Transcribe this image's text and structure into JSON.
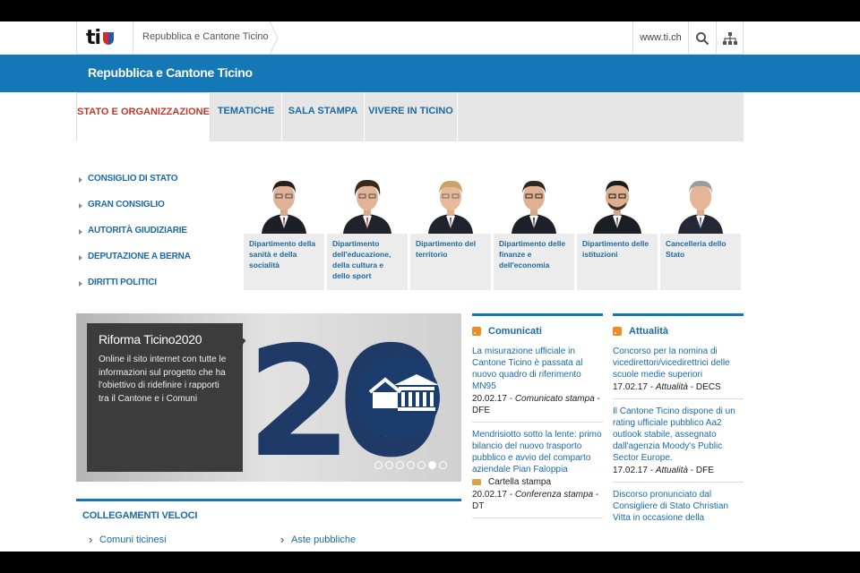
{
  "topbar": {
    "logo_text": "ti",
    "breadcrumb": "Repubblica e Cantone Ticino",
    "site_link": "www.ti.ch",
    "search_icon": "search-icon",
    "sitemap_icon": "sitemap-icon"
  },
  "band": {
    "title": "Repubblica e Cantone Ticino"
  },
  "tabs": [
    {
      "label": "STATO E ORGANIZZAZIONE",
      "active": true
    },
    {
      "label": "TEMATICHE"
    },
    {
      "label": "SALA STAMPA"
    },
    {
      "label": "VIVERE IN TICINO"
    }
  ],
  "leftnav": [
    {
      "label": "CONSIGLIO DI STATO"
    },
    {
      "label": "GRAN CONSIGLIO"
    },
    {
      "label": "AUTORITÀ GIUDIZIARIE"
    },
    {
      "label": "DEPUTAZIONE A BERNA"
    },
    {
      "label": "DIRITTI POLITICI"
    }
  ],
  "departments": [
    {
      "label": "Dipartimento della sanità e della socialità"
    },
    {
      "label": "Dipartimento dell'educazione, della cultura e dello sport"
    },
    {
      "label": "Dipartimento del territorio"
    },
    {
      "label": "Dipartimento delle finanze e dell'economia"
    },
    {
      "label": "Dipartimento delle istituzioni"
    },
    {
      "label": "Cancelleria dello Stato"
    }
  ],
  "hero": {
    "title": "Riforma Ticino2020",
    "text": "Online il sito internet con tutte le informazioni sul progetto che ha l'obiettivo di ridefinire i rapporti tra il Cantone e i Comuni",
    "art_text": "20",
    "slides_total": 6,
    "active_slide": 5
  },
  "quick_links": {
    "title": "COLLEGAMENTI VELOCI",
    "items": [
      "Comuni ticinesi",
      "Aste pubbliche"
    ]
  },
  "comunicati": {
    "title": "Comunicati",
    "items": [
      {
        "text": "La misurazione ufficiale in Cantone Ticino è passata al nuovo quadro di riferimento MN95",
        "date": "20.02.17",
        "type": "Comunicato stampa",
        "dept": "DFE"
      },
      {
        "text": "Mendrisiotto sotto la lente: primo bilancio del nuovo trasporto pubblico e avvio del comparto aziendale Pian Faloppia",
        "folder": "Cartella stampa",
        "date": "20.02.17",
        "type": "Conferenza stampa",
        "dept": "DT"
      }
    ]
  },
  "attualita": {
    "title": "Attualità",
    "items": [
      {
        "text": "Concorso per la nomina di vicedirettori/vicedirettrici delle scuole medie superiori",
        "date": "17.02.17",
        "type": "Attualità",
        "dept": "DECS"
      },
      {
        "text": "Il Cantone Ticino dispone di un rating ufficiale pubblico Aa2 outlook stabile, assegnato dall'agenzia Moody's Public Sector Europe.",
        "date": "17.02.17",
        "type": "Attualità",
        "dept": "DFE"
      },
      {
        "text": "Discorso pronunciato dal Consigliere di Stato Christian Vitta in occasione della"
      }
    ]
  },
  "colors": {
    "brand_blue": "#1477b6",
    "link_blue": "#1b6aa5",
    "active_red": "#c0392b",
    "rss_orange": "#f08a24"
  }
}
